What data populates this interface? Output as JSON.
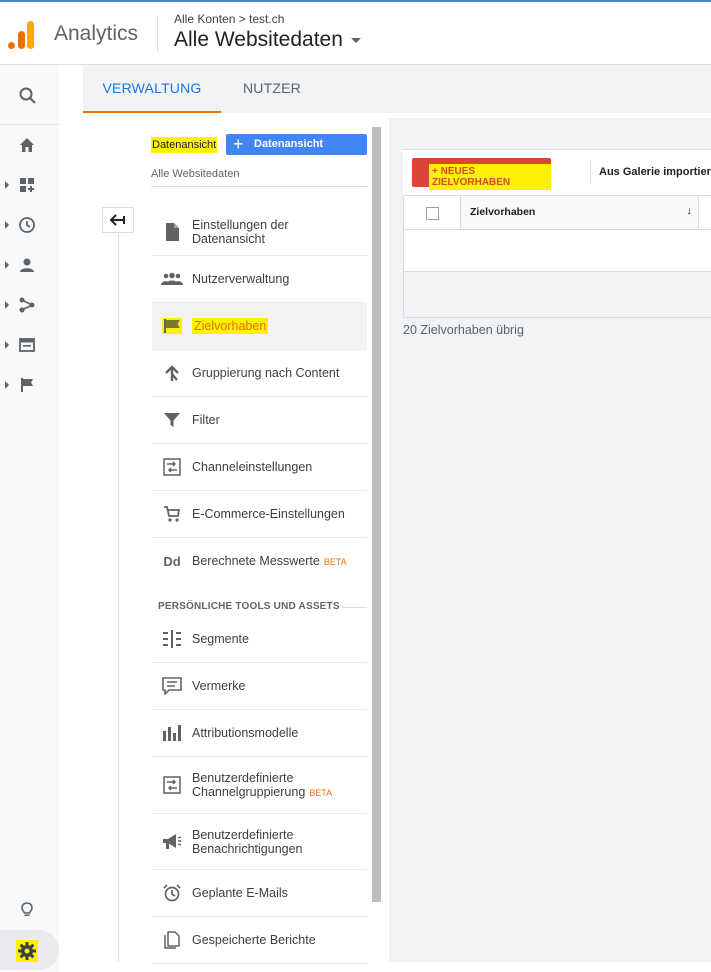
{
  "header": {
    "app_name": "Analytics",
    "breadcrumb": "Alle Konten > test.ch",
    "view_title": "Alle Websitedaten"
  },
  "tabs": [
    {
      "label": "VERWALTUNG",
      "active": true
    },
    {
      "label": "NUTZER",
      "active": false
    }
  ],
  "view_column": {
    "label": "Datenansicht",
    "create_button": "Datenansicht erstellen",
    "current_view": "Alle Websitedaten"
  },
  "menu": [
    {
      "label": "Einstellungen der Datenansicht",
      "icon": "document-icon"
    },
    {
      "label": "Nutzerverwaltung",
      "icon": "people-icon"
    },
    {
      "label": "Zielvorhaben",
      "icon": "flag-icon",
      "active": true
    },
    {
      "label": "Gruppierung nach Content",
      "icon": "merge-icon"
    },
    {
      "label": "Filter",
      "icon": "filter-icon"
    },
    {
      "label": "Channeleinstellungen",
      "icon": "channel-icon"
    },
    {
      "label": "E-Commerce-Einstellungen",
      "icon": "cart-icon"
    },
    {
      "label": "Berechnete Messwerte",
      "icon": "dd-icon",
      "beta": "BETA"
    }
  ],
  "personal_section": {
    "title": "PERSÖNLICHE TOOLS UND ASSETS",
    "items": [
      {
        "label": "Segmente",
        "icon": "segments-icon"
      },
      {
        "label": "Vermerke",
        "icon": "comment-icon"
      },
      {
        "label": "Attributionsmodelle",
        "icon": "bar-chart-icon"
      },
      {
        "label": "Benutzerdefinierte Channelgruppierung",
        "icon": "channel-icon",
        "beta": "BETA"
      },
      {
        "label": "Benutzerdefinierte Benachrichtigungen",
        "icon": "megaphone-icon"
      },
      {
        "label": "Geplante E-Mails",
        "icon": "alarm-icon"
      },
      {
        "label": "Gespeicherte Berichte",
        "icon": "saved-report-icon"
      }
    ]
  },
  "goals": {
    "new_goal_button": "+ NEUES ZIELVORHABEN",
    "gallery_import": "Aus Galerie importieren",
    "column_header": "Zielvorhaben",
    "next_column_initial": "I",
    "remaining": "20 Zielvorhaben übrig"
  },
  "colors": {
    "accent_blue": "#1a73e8",
    "accent_orange": "#e8710a",
    "highlight_yellow": "#fff200",
    "button_red": "#db4437"
  }
}
